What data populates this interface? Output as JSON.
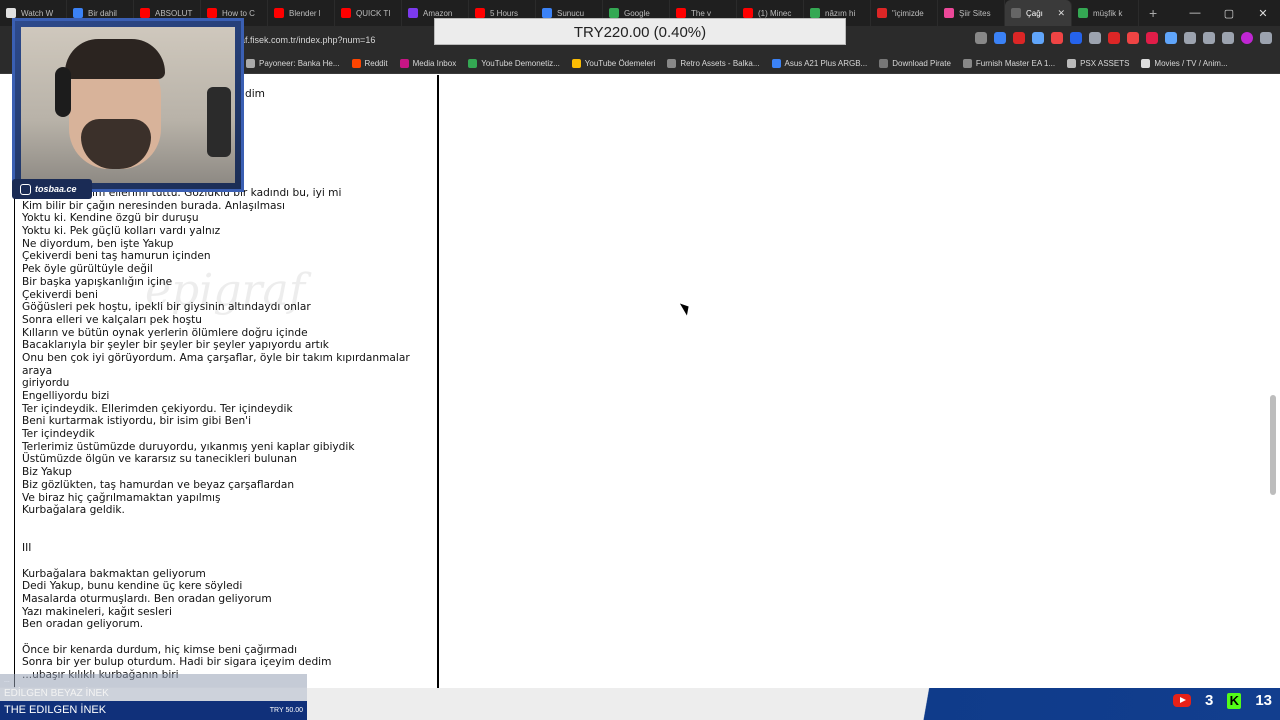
{
  "browser": {
    "tabs": [
      {
        "label": "Watch W",
        "color": "#e0e0e0"
      },
      {
        "label": "Bir dahil",
        "color": "#3b82f6"
      },
      {
        "label": "ABSOLUT",
        "color": "#ff0000"
      },
      {
        "label": "How to C",
        "color": "#ff0000"
      },
      {
        "label": "Blender l",
        "color": "#ff0000"
      },
      {
        "label": "QUICK TI",
        "color": "#ff0000"
      },
      {
        "label": "Amazon",
        "color": "#7c3aed"
      },
      {
        "label": "5 Hours",
        "color": "#ff0000"
      },
      {
        "label": "Sunucu",
        "color": "#3b82f6"
      },
      {
        "label": "Google",
        "color": "#34a853"
      },
      {
        "label": "The v",
        "color": "#ff0000"
      },
      {
        "label": "(1) Minec",
        "color": "#ff0000"
      },
      {
        "label": "nâzım hi",
        "color": "#34a853"
      },
      {
        "label": "\"içimizde",
        "color": "#dc2626"
      },
      {
        "label": "Şiir Sites",
        "color": "#ec4899"
      },
      {
        "label": "Çağı",
        "color": "#666666",
        "active": true
      },
      {
        "label": "müşfik k",
        "color": "#34a853"
      }
    ],
    "new_tab": "+",
    "url_prefix": "",
    "url_domain": "graf.fisek.com.tr",
    "url_path": "/index.php?num=16",
    "bookmarks": [
      {
        "label": "Payoneer: Banka He...",
        "color": "#aaaaaa"
      },
      {
        "label": "Reddit",
        "color": "#ff4500"
      },
      {
        "label": "Media Inbox",
        "color": "#c71585"
      },
      {
        "label": "YouTube Demonetiz...",
        "color": "#34a853"
      },
      {
        "label": "YouTube Ödemeleri",
        "color": "#fbbc04"
      },
      {
        "label": "Retro Assets - Balka...",
        "color": "#888888"
      },
      {
        "label": "Asus A21 Plus ARGB...",
        "color": "#3b82f6"
      },
      {
        "label": "Download Pirate",
        "color": "#777777"
      },
      {
        "label": "Furnish Master EA 1...",
        "color": "#888888"
      },
      {
        "label": "PSX ASSETS",
        "color": "#bbbbbb"
      },
      {
        "label": "Movies / TV / Anim...",
        "color": "#dddddd"
      }
    ]
  },
  "ticker": {
    "text": "TRY220.00 (0.40%)"
  },
  "poem": {
    "top_fragment": "dim",
    "watermark": "epigraf",
    "lines": [
      {
        "text": "ir avukat benim ellerimi tuttu. Gözlüklü bir kadındı bu, iyi mi"
      },
      {
        "text": "Kim bilir bir çağın neresinden burada. Anlaşılması"
      },
      {
        "text": "Yoktu ki. Kendine özgü bir duruşu"
      },
      {
        "text": "Yoktu ki. Pek güçlü kolları vardı yalnız"
      },
      {
        "text": "Ne diyordum, ben işte Yakup"
      },
      {
        "text": "Çekiverdi beni taş hamurun içinden"
      },
      {
        "text": "Pek öyle gürültüyle değil"
      },
      {
        "text": "Bir başka yapışkanlığın içine"
      },
      {
        "text": "Çekiverdi beni"
      },
      {
        "text": "Göğüsleri pek hoştu, ipekli bir giysinin altındaydı onlar"
      },
      {
        "text": "Sonra elleri ve kalçaları pek hoştu"
      },
      {
        "text": "Kılların ve bütün oynak yerlerin ölümlere doğru içinde"
      },
      {
        "text": "Bacaklarıyla bir şeyler bir şeyler bir şeyler yapıyordu artık"
      },
      {
        "text": "Onu ben çok iyi görüyordum. Ama çarşaflar, öyle bir takım kıpırdanmalar araya",
        "wrap": true
      },
      {
        "text": "giriyordu"
      },
      {
        "text": "Engelliyordu bizi"
      },
      {
        "text": "Ter içindeydik. Ellerimden çekiyordu. Ter içindeydik"
      },
      {
        "text": "Beni kurtarmak istiyordu, bir isim gibi Ben'i"
      },
      {
        "text": "Ter içindeydik"
      },
      {
        "text": "Terlerimiz üstümüzde duruyordu, yıkanmış yeni kaplar gibiydik"
      },
      {
        "text": "Üstümüzde ölgün ve kararsız su tanecikleri bulunan"
      },
      {
        "text": "Biz Yakup"
      },
      {
        "text": "Biz gözlükten, taş hamurdan ve beyaz çarşaflardan"
      },
      {
        "text": "Ve biraz hiç çağrılmamaktan yapılmış"
      },
      {
        "text": "Kurbağalara geldik."
      },
      {
        "text": ""
      },
      {
        "text": ""
      },
      {
        "text": "III"
      },
      {
        "text": ""
      },
      {
        "text": "Kurbağalara bakmaktan geliyorum"
      },
      {
        "text": "Dedi Yakup, bunu kendine üç kere söyledi"
      },
      {
        "text": "Masalarda oturmuşlardı. Ben oradan geliyorum"
      },
      {
        "text": "Yazı makineleri, kağıt sesleri"
      },
      {
        "text": "Ben oradan geliyorum."
      },
      {
        "text": ""
      },
      {
        "text": "Önce bir kenarda durdum, hiç kimse beni çağırmadı"
      },
      {
        "text": "Sonra bir yer bulup oturdum. Hadi bir sigara içeyim dedim"
      },
      {
        "text": "...ubaşır kılıklı kurbağanın biri"
      }
    ]
  },
  "stream": {
    "instagram": "tosbaa.ce",
    "ticker_line": "...",
    "song_upper": "EDİLGEN BEYAZ İNEK",
    "song_title": "THE EDILGEN İNEK",
    "song_price": "TRY 50.00",
    "youtube_count": "3",
    "kick_count": "13",
    "kick_letter": "K"
  },
  "window_controls": {
    "minimize": "—",
    "maximize": "▢",
    "close": "✕"
  }
}
